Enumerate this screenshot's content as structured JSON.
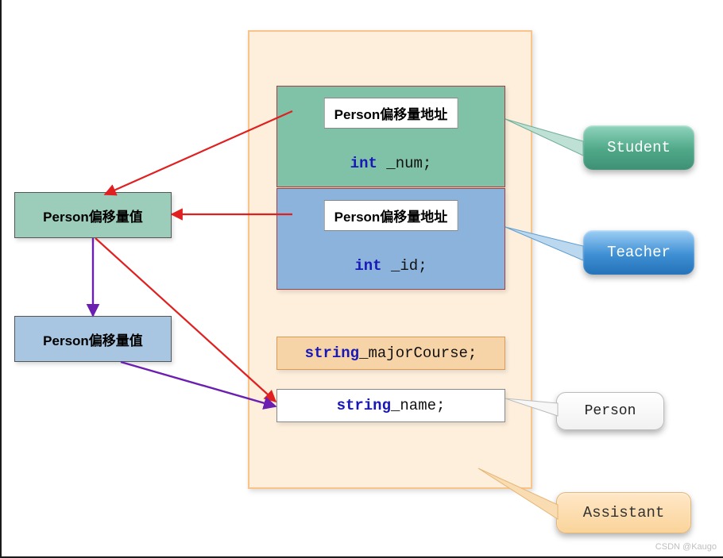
{
  "left": {
    "offset_green": "Person偏移量值",
    "offset_blue": "Person偏移量值"
  },
  "student": {
    "addr_label": "Person偏移量地址",
    "member_kw": "int",
    "member_name": " _num;"
  },
  "teacher": {
    "addr_label": "Person偏移量地址",
    "member_kw": "int",
    "member_name": " _id;"
  },
  "major": {
    "kw": "string",
    "name": " _majorCourse;"
  },
  "person_member": {
    "kw": "string",
    "name": " _name;"
  },
  "callouts": {
    "student": "Student",
    "teacher": "Teacher",
    "person": "Person",
    "assistant": "Assistant"
  },
  "watermark": "CSDN @Kaugo"
}
